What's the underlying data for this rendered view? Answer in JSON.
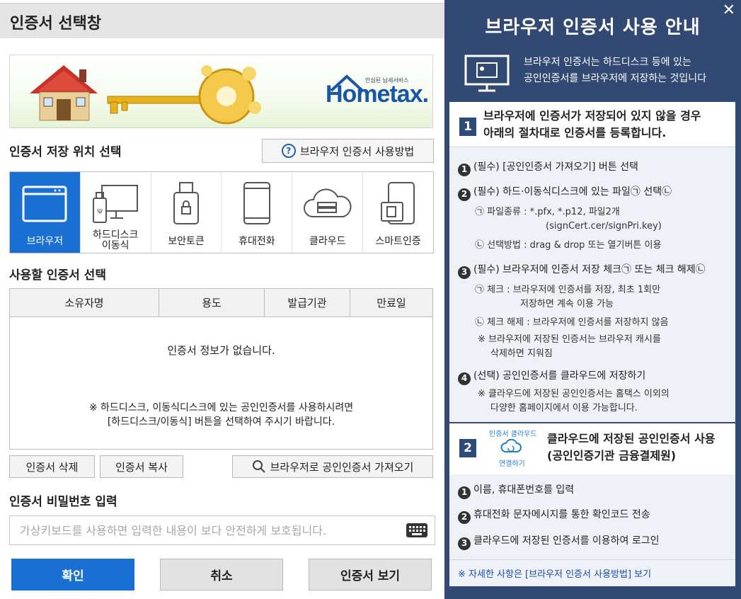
{
  "dialog": {
    "title": "인증서 선택창",
    "banner": {
      "logo_small": "안심된 납세서비스",
      "logo_big": "Hometax."
    },
    "storage_label": "인증서 저장 위치 선택",
    "help_button": "브라우저 인증서 사용방법",
    "locations": [
      {
        "label": "브라우저",
        "icon": "browser-icon",
        "active": true
      },
      {
        "label": "하드디스크\n이동식",
        "icon": "harddisk-usb-icon",
        "active": false
      },
      {
        "label": "보안토큰",
        "icon": "security-token-icon",
        "active": false
      },
      {
        "label": "휴대전화",
        "icon": "mobile-phone-icon",
        "active": false
      },
      {
        "label": "클라우드",
        "icon": "cloud-icon",
        "active": false
      },
      {
        "label": "스마트인증",
        "icon": "smart-auth-icon",
        "active": false
      }
    ],
    "cert_select_label": "사용할 인증서 선택",
    "table": {
      "columns": [
        "소유자명",
        "용도",
        "발급기관",
        "만료일"
      ],
      "empty_message": "인증서 정보가 없습니다.",
      "hint_line1": "※ 하드디스크, 이동식디스크에 있는 공인인증서를 사용하시려면",
      "hint_line2": "[하드디스크/이동식] 버튼을 선택하여 주시기 바랍니다."
    },
    "actions": {
      "delete": "인증서 삭제",
      "copy": "인증서 복사",
      "import": "브라우저로 공인인증서 가져오기"
    },
    "password_label": "인증서 비밀번호 입력",
    "password_placeholder": "가상키보드를 사용하면 입력한 내용이 보다 안전하게 보호됩니다.",
    "buttons": {
      "ok": "확인",
      "cancel": "취소",
      "view": "인증서 보기"
    }
  },
  "guide": {
    "close": "✕",
    "title": "브라우저 인증서 사용 안내",
    "intro_line1": "브라우저 인증서는 하드디스크 등에 있는",
    "intro_line2": "공인인증서를 브라우저에 저장하는 것입니다",
    "section1": {
      "num": "1",
      "line1": "브라우저에 인증서가 저장되어 있지 않을 경우",
      "line2": "아래의 절차대로 인증서를 등록합니다."
    },
    "steps": {
      "s1": {
        "n": "1",
        "text": "(필수) [공인인증서 가져오기] 버튼 선택"
      },
      "s2": {
        "n": "2",
        "text": "(필수) 하드·이동식디스크에 있는 파일㉠ 선택㉡"
      },
      "s2a": "㉠ 파일종류 : *.pfx, *.p12, 파일2개",
      "s2a2": "(signCert.cer/signPri.key)",
      "s2b": "㉡ 선택방법 : drag & drop 또는 열기버튼 이용",
      "s3": {
        "n": "3",
        "text": "(필수) 브라우저에 인증서 저장 체크㉠ 또는 체크 해제㉡"
      },
      "s3a": "㉠ 체크 :  브라우저에 인증서를 저장, 최초 1회만",
      "s3a2": "저장하면 계속 이용 가능",
      "s3b": "㉡ 체크 해제 : 브라우저에 인증서를 저장하지 않음",
      "s3c": "※ 브라우저에 저장된 인증서는 브라우저 캐시를",
      "s3c2": "삭제하면 지워짐",
      "s4": {
        "n": "4",
        "text": "(선택) 공인인증서를 클라우드에 저장하기"
      },
      "s4a": "※ 클라우드에 저장된 공인인증서는 홈택스 이외의",
      "s4a2": "다양한 홈페이지에서 이용 가능합니다."
    },
    "section2": {
      "num": "2",
      "cloud_top": "인증서 클라우드",
      "cloud_bottom": "연결하기",
      "line1": "클라우드에 저장된 공인인증서 사용",
      "line2": "(공인인증기관 금융결제원)"
    },
    "cloud_steps": [
      {
        "n": "1",
        "text": "이름, 휴대폰번호를 입력"
      },
      {
        "n": "2",
        "text": "휴대전화 문자메시지를 통한 확인코드 전송"
      },
      {
        "n": "3",
        "text": "클라우드에 저장된 인증서를 이용하여 로그인"
      }
    ],
    "footer": "※ 자세한 사항은 [브라우저 인증서 사용방법] 보기"
  }
}
